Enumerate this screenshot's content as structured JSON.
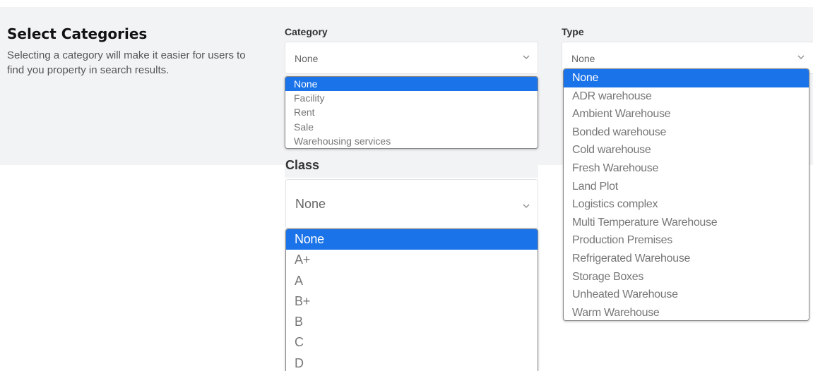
{
  "intro": {
    "title": "Select Categories",
    "description": "Selecting a category will make it easier for users to find you property in search results."
  },
  "category": {
    "label": "Category",
    "value": "None",
    "options": [
      "None",
      "Facility",
      "Rent",
      "Sale",
      "Warehousing services"
    ]
  },
  "type": {
    "label": "Type",
    "value": "None",
    "options": [
      "None",
      "ADR warehouse",
      "Ambient Warehouse",
      "Bonded warehouse",
      "Cold warehouse",
      "Fresh Warehouse",
      "Land Plot",
      "Logistics complex",
      "Multi Temperature Warehouse",
      "Production Premises",
      "Refrigerated Warehouse",
      "Storage Boxes",
      "Unheated Warehouse",
      "Warm Warehouse"
    ]
  },
  "class": {
    "label": "Class",
    "value": "None",
    "options": [
      "None",
      "A+",
      "A",
      "B+",
      "B",
      "C",
      "D"
    ]
  },
  "icons": {
    "select_arrow": "chevron-down-icon"
  },
  "colors": {
    "selected_option": "#1a73e8",
    "panel_background": "#f2f3f5"
  }
}
